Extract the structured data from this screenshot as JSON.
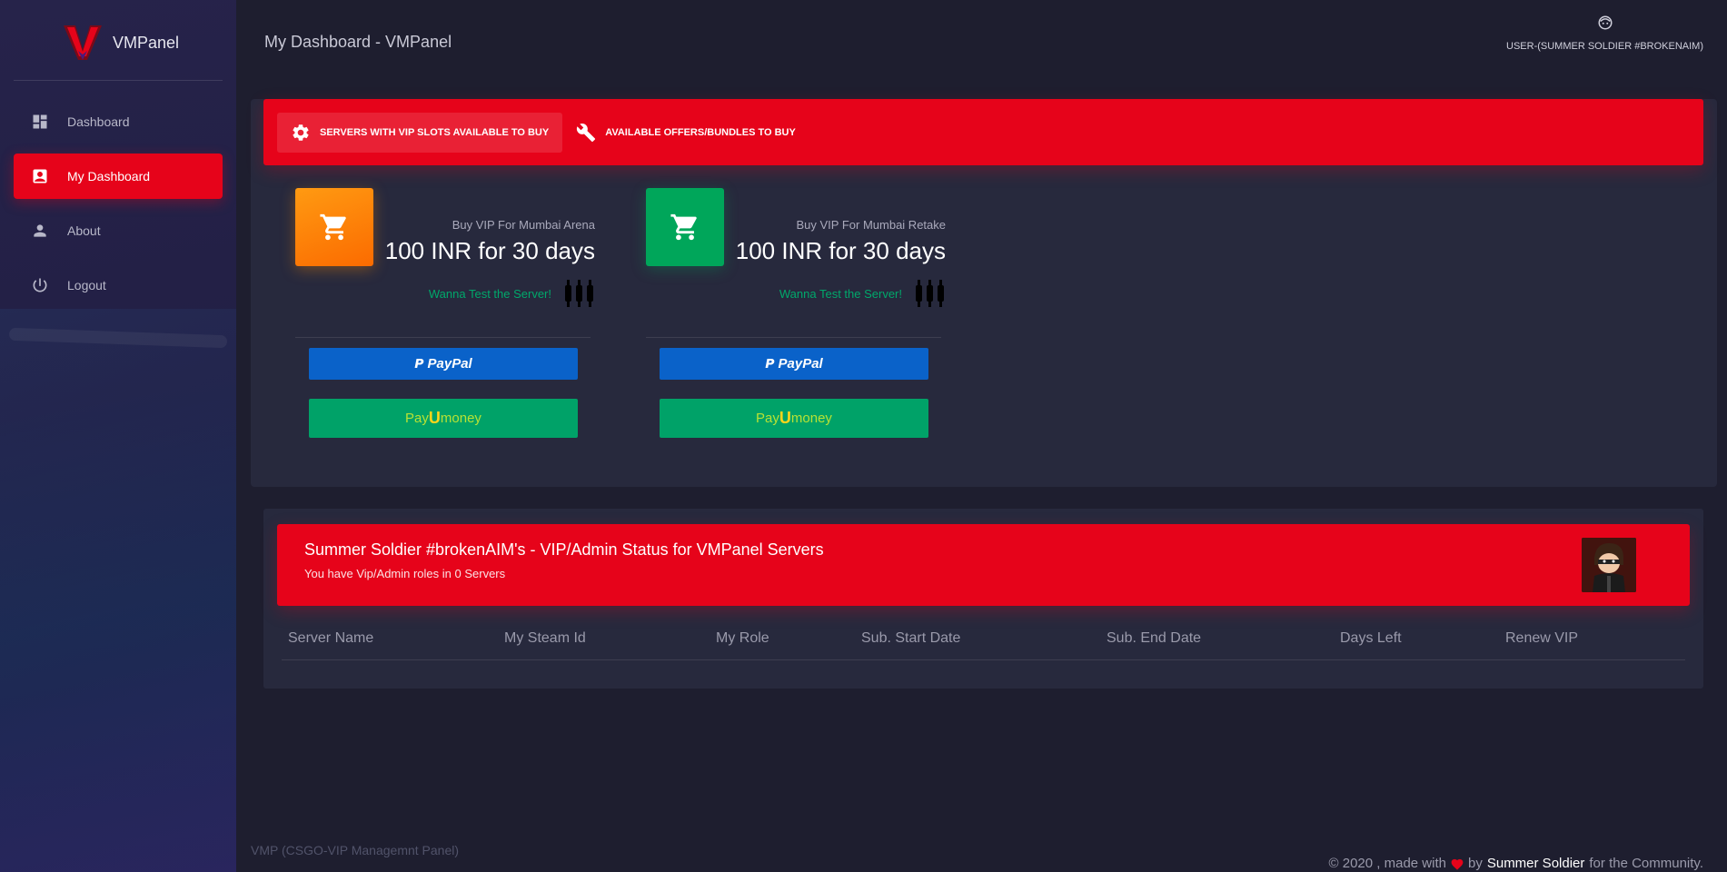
{
  "brand": {
    "name": "VMPanel"
  },
  "sidebar": {
    "items": [
      {
        "label": "Dashboard",
        "icon": "dashboard-icon",
        "active": false
      },
      {
        "label": "My Dashboard",
        "icon": "contact-card-icon",
        "active": true
      },
      {
        "label": "About",
        "icon": "person-icon",
        "active": false
      },
      {
        "label": "Logout",
        "icon": "power-icon",
        "active": false
      }
    ]
  },
  "header": {
    "title": "My Dashboard - VMPanel",
    "user": "USER-(SUMMER SOLDIER #BROKENAIM)"
  },
  "store": {
    "tabs": [
      {
        "label": "SERVERS WITH VIP SLOTS AVAILABLE TO BUY",
        "icon": "gear-icon",
        "active": true
      },
      {
        "label": "AVAILABLE OFFERS/BUNDLES TO BUY",
        "icon": "wrench-icon",
        "active": false
      }
    ],
    "products": [
      {
        "subtitle": "Buy VIP For Mumbai Arena",
        "price": "100 INR for 30 days",
        "test_link": "Wanna Test the Server!",
        "cart_color": "#fb8c00",
        "paypal_label": "PayPal",
        "payu_label_pre": "Pay",
        "payu_label_u": "U",
        "payu_label_post": "money"
      },
      {
        "subtitle": "Buy VIP For Mumbai Retake",
        "price": "100 INR for 30 days",
        "test_link": "Wanna Test the Server!",
        "cart_color": "#00a65a",
        "paypal_label": "PayPal",
        "payu_label_pre": "Pay",
        "payu_label_u": "U",
        "payu_label_post": "money"
      }
    ]
  },
  "status": {
    "title": "Summer Soldier #brokenAIM's - VIP/Admin Status for VMPanel Servers",
    "subtitle": "You have Vip/Admin roles in 0 Servers",
    "columns": [
      "Server Name",
      "My Steam Id",
      "My Role",
      "Sub. Start Date",
      "Sub. End Date",
      "Days Left",
      "Renew VIP"
    ]
  },
  "footer": {
    "left": "VMP (CSGO-VIP Managemnt Panel)",
    "right_pre": "© 2020 , made with",
    "right_by": "by",
    "right_author": "Summer Soldier",
    "right_post": "for the Community."
  },
  "colors": {
    "accent": "#e6031a",
    "background": "#1e1e2f",
    "card": "#27293d",
    "paypal": "#0a62c9",
    "payu": "#00a268"
  }
}
